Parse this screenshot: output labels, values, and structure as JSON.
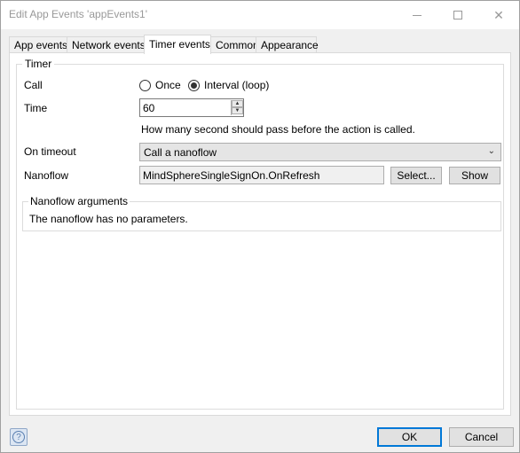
{
  "window": {
    "title": "Edit App Events 'appEvents1'",
    "icons": {
      "minimize": "minimize-icon",
      "maximize": "maximize-icon",
      "close": "close-icon"
    }
  },
  "tabs": [
    {
      "label": "App events"
    },
    {
      "label": "Network events"
    },
    {
      "label": "Timer events",
      "active": true
    },
    {
      "label": "Common"
    },
    {
      "label": "Appearance"
    }
  ],
  "timer": {
    "group_label": "Timer",
    "call_label": "Call",
    "call_options": [
      "Once",
      "Interval (loop)"
    ],
    "call_selected": "Interval (loop)",
    "time_label": "Time",
    "time_value": "60",
    "time_help": "How many second should pass before the action is called.",
    "on_timeout_label": "On timeout",
    "on_timeout_value": "Call a nanoflow",
    "nanoflow_label": "Nanoflow",
    "nanoflow_value": "MindSphereSingleSignOn.OnRefresh",
    "select_button": "Select...",
    "show_button": "Show",
    "arguments_group_label": "Nanoflow arguments",
    "arguments_text": "The nanoflow has no parameters."
  },
  "footer": {
    "ok_label": "OK",
    "cancel_label": "Cancel",
    "help_icon": "help-icon"
  },
  "colors": {
    "accent": "#0078d7",
    "panel": "#ffffff",
    "chrome": "#f0f0f0"
  }
}
